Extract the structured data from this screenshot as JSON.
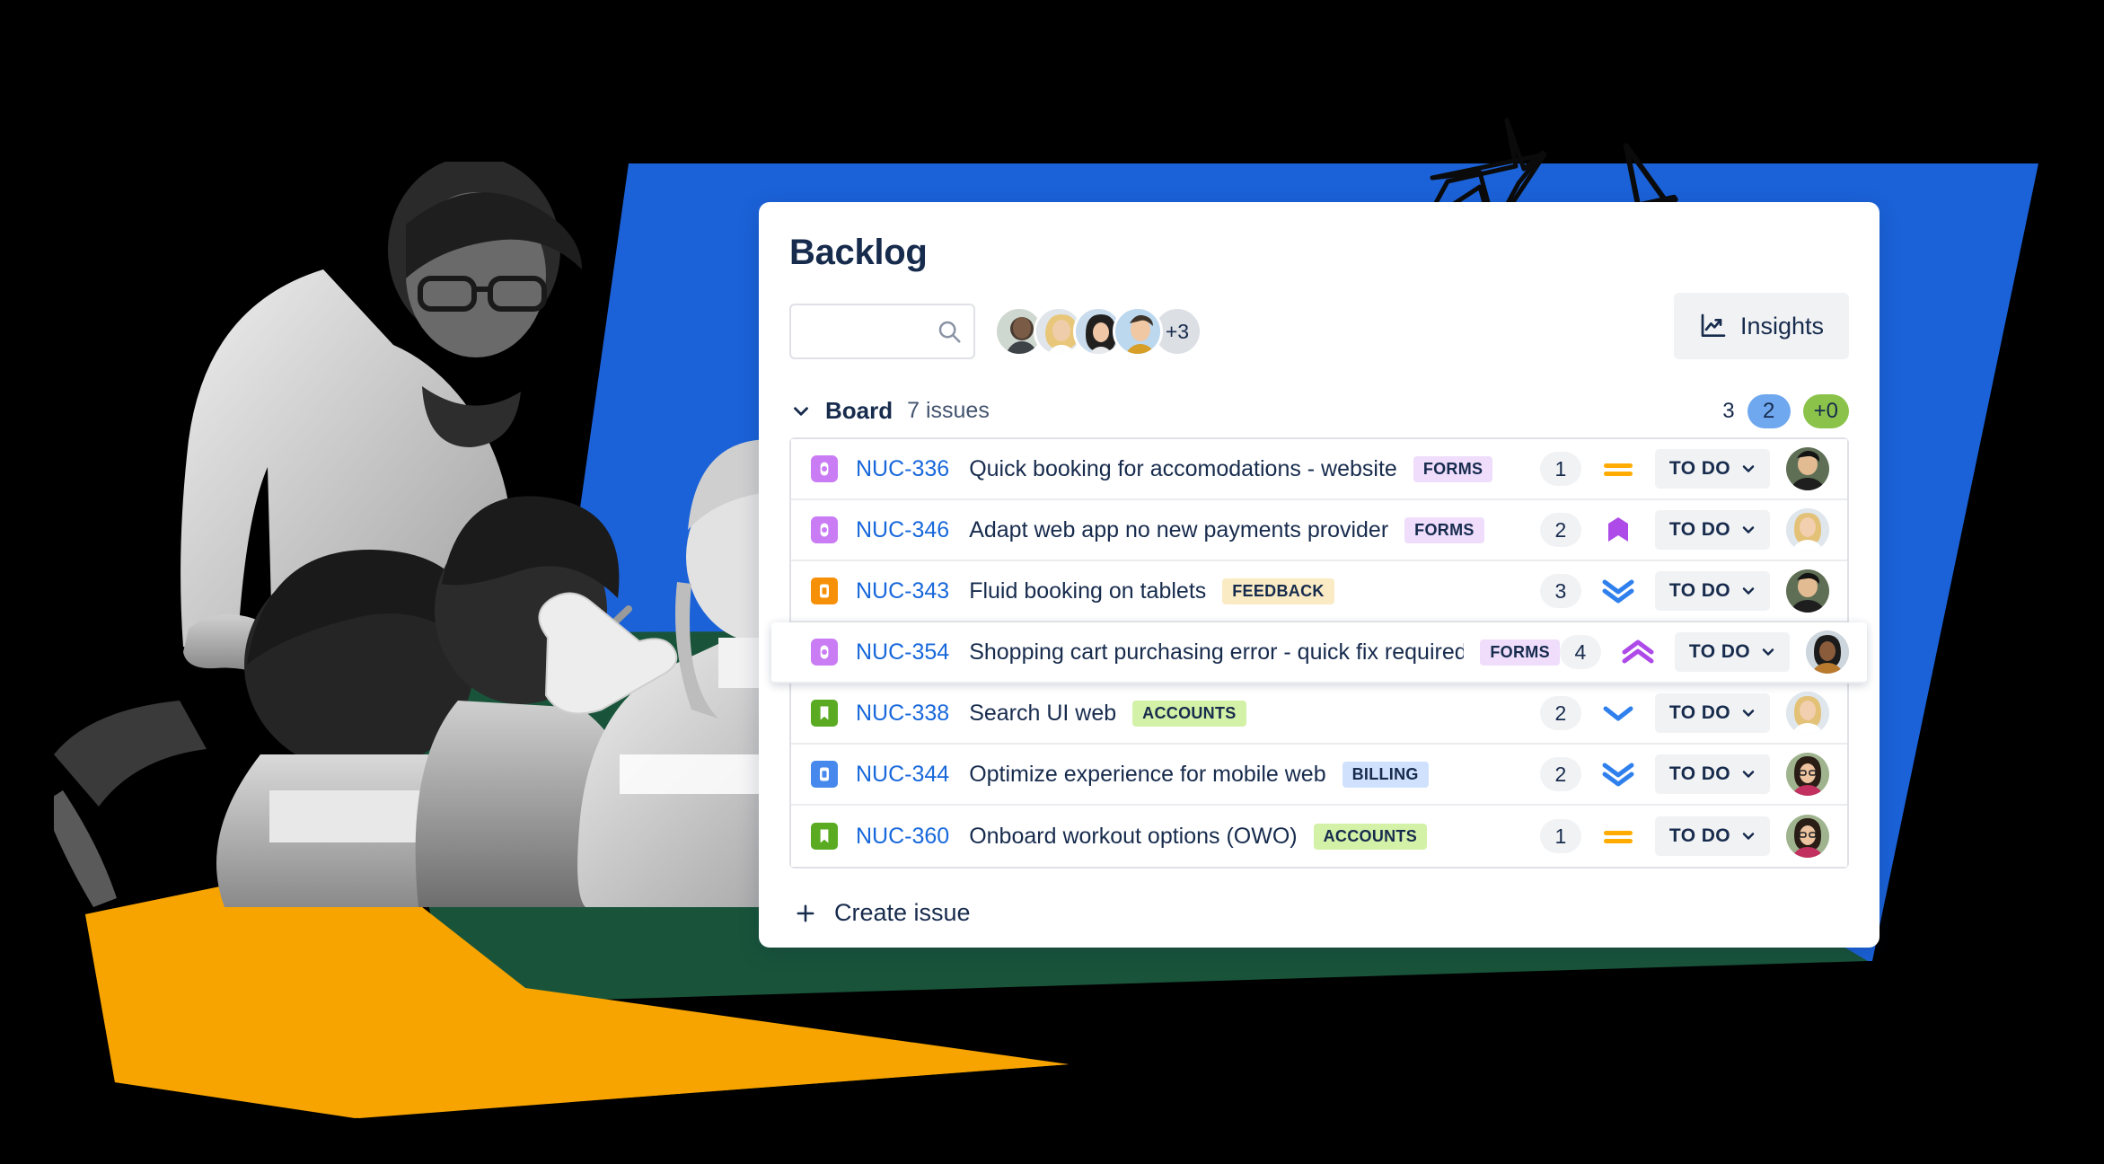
{
  "page": {
    "title": "Backlog"
  },
  "search": {
    "value": "",
    "placeholder": "",
    "icon": "search-icon"
  },
  "avatars": {
    "overflow_label": "+3",
    "members": [
      {
        "name": "member-1"
      },
      {
        "name": "member-2"
      },
      {
        "name": "member-3"
      },
      {
        "name": "member-4"
      }
    ]
  },
  "insights": {
    "label": "Insights",
    "icon": "insights-chart-icon"
  },
  "board": {
    "label": "Board",
    "issue_count": "7 issues",
    "toggle_icon": "chevron-down-icon",
    "stats": [
      {
        "value": "3",
        "style": "plain",
        "color": "transparent"
      },
      {
        "value": "2",
        "style": "pill",
        "color": "#6FA8EF"
      },
      {
        "value": "+0",
        "style": "pill",
        "color": "#8BC34A"
      }
    ]
  },
  "colors": {
    "brand_blue": "#1868DB",
    "shape_blue": "#1B62D8",
    "shape_green": "#19543A",
    "shape_orange": "#F7A400",
    "link_blue": "#1868DB",
    "text_dark": "#172B4D",
    "priority_medium": "#FFAB00",
    "priority_low": "#2F80ED",
    "priority_high": "#AE4AE8"
  },
  "issues": [
    {
      "type_icon": "story-purple-icon",
      "type_color": "#C97CF4",
      "key": "NUC-336",
      "summary": "Quick booking for accomodations - website",
      "label": "FORMS",
      "label_bg": "#EFDDFB",
      "points": "1",
      "priority_icon": "priority-medium-icon",
      "status": "TO DO",
      "status_chevron": "chevron-down-icon",
      "assignee": "assignee-1",
      "highlighted": false
    },
    {
      "type_icon": "story-purple-icon",
      "type_color": "#C97CF4",
      "key": "NUC-346",
      "summary": "Adapt web app no new payments provider",
      "label": "FORMS",
      "label_bg": "#EFDDFB",
      "points": "2",
      "priority_icon": "priority-highest-flag-icon",
      "status": "TO DO",
      "status_chevron": "chevron-down-icon",
      "assignee": "assignee-2",
      "highlighted": false
    },
    {
      "type_icon": "task-orange-icon",
      "type_color": "#F79009",
      "key": "NUC-343",
      "summary": "Fluid booking on tablets",
      "label": "FEEDBACK",
      "label_bg": "#FBEBC4",
      "points": "3",
      "priority_icon": "priority-low-double-down-icon",
      "status": "TO DO",
      "status_chevron": "chevron-down-icon",
      "assignee": "assignee-1",
      "highlighted": false
    },
    {
      "type_icon": "story-purple-icon",
      "type_color": "#C97CF4",
      "key": "NUC-354",
      "summary": "Shopping cart purchasing error - quick fix required",
      "label": "FORMS",
      "label_bg": "#EFDDFB",
      "points": "4",
      "priority_icon": "priority-high-double-up-icon",
      "status": "TO DO",
      "status_chevron": "chevron-down-icon",
      "assignee": "assignee-3",
      "highlighted": true
    },
    {
      "type_icon": "story-green-bookmark-icon",
      "type_color": "#5AAB22",
      "key": "NUC-338",
      "summary": "Search UI web",
      "label": "ACCOUNTS",
      "label_bg": "#D3F1A7",
      "points": "2",
      "priority_icon": "priority-lowest-single-down-icon",
      "status": "TO DO",
      "status_chevron": "chevron-down-icon",
      "assignee": "assignee-2",
      "highlighted": false
    },
    {
      "type_icon": "task-blue-icon",
      "type_color": "#4688EC",
      "key": "NUC-344",
      "summary": "Optimize experience for mobile web",
      "label": "BILLING",
      "label_bg": "#CFE1FD",
      "points": "2",
      "priority_icon": "priority-low-double-down-icon",
      "status": "TO DO",
      "status_chevron": "chevron-down-icon",
      "assignee": "assignee-4",
      "highlighted": false
    },
    {
      "type_icon": "story-green-bookmark-icon",
      "type_color": "#5AAB22",
      "key": "NUC-360",
      "summary": "Onboard workout options (OWO)",
      "label": "ACCOUNTS",
      "label_bg": "#D3F1A7",
      "points": "1",
      "priority_icon": "priority-medium-icon",
      "status": "TO DO",
      "status_chevron": "chevron-down-icon",
      "assignee": "assignee-4",
      "highlighted": false
    }
  ],
  "create_issue": {
    "label": "Create issue",
    "icon": "plus-icon"
  }
}
